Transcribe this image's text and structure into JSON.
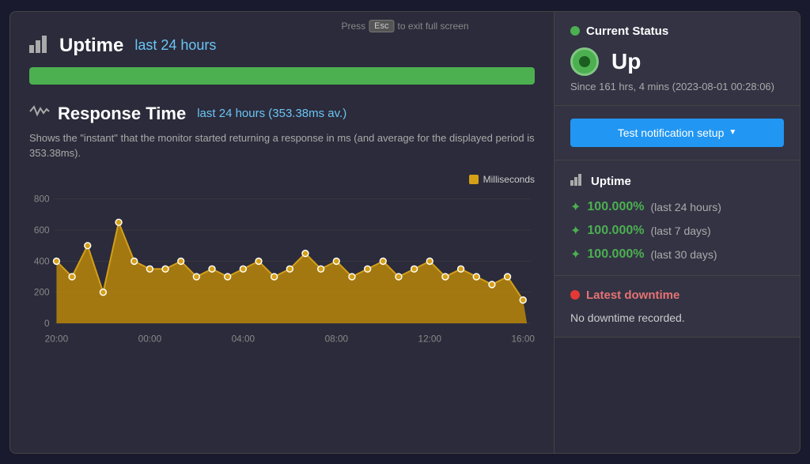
{
  "fullscreen_hint": {
    "press": "Press",
    "esc": "Esc",
    "to_exit": "to exit full screen"
  },
  "main": {
    "uptime_title": "Uptime",
    "uptime_subtitle": "last 24 hours",
    "progress_percent": 100,
    "response_title": "Response Time",
    "response_subtitle": "last 24 hours (353.38ms av.)",
    "response_desc": "Shows the \"instant\" that the monitor started returning a response in ms (and average for the displayed period is 353.38ms).",
    "chart_legend": "Milliseconds",
    "chart_x_labels": [
      "20:00",
      "00:00",
      "04:00",
      "08:00",
      "12:00",
      "16:00"
    ],
    "chart_y_labels": [
      "800",
      "600",
      "400",
      "200",
      "0"
    ]
  },
  "sidebar": {
    "current_status": {
      "title": "Current Status",
      "status": "Up",
      "since_text": "Since 161 hrs, 4 mins (2023-08-01 00:28:06)"
    },
    "test_button": "Test notification setup",
    "uptime": {
      "title": "Uptime",
      "stats": [
        {
          "percent": "100.000%",
          "period": "(last 24 hours)"
        },
        {
          "percent": "100.000%",
          "period": "(last 7 days)"
        },
        {
          "percent": "100.000%",
          "period": "(last 30 days)"
        }
      ]
    },
    "latest_downtime": {
      "title": "Latest downtime",
      "message": "No downtime recorded."
    }
  }
}
